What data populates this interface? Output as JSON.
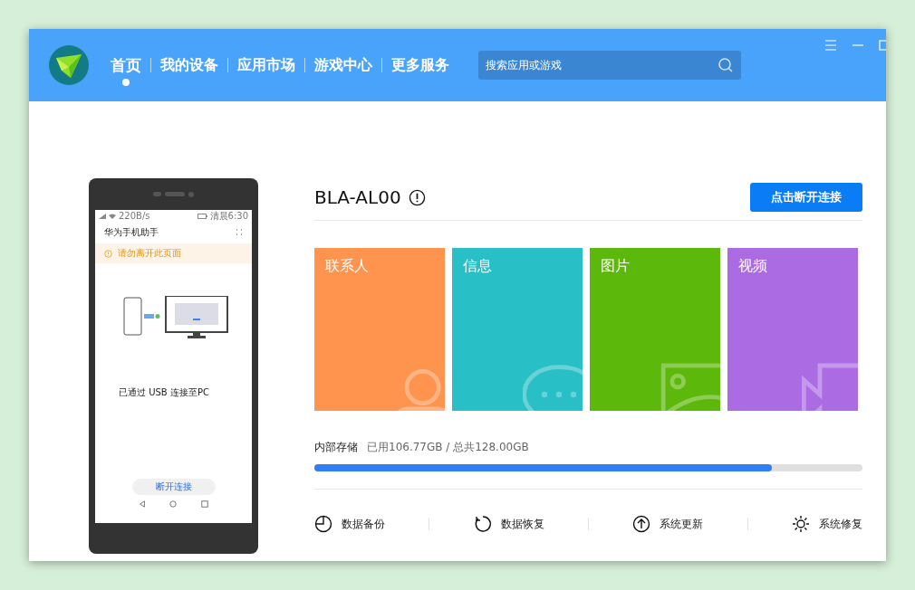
{
  "nav": {
    "items": [
      {
        "label": "首页",
        "selected": true
      },
      {
        "label": "我的设备",
        "selected": false
      },
      {
        "label": "应用市场",
        "selected": false
      },
      {
        "label": "游戏中心",
        "selected": false
      },
      {
        "label": "更多服务",
        "selected": false
      }
    ],
    "search": {
      "placeholder": "搜索应用或游戏"
    }
  },
  "phone": {
    "status_speed": "220B/s",
    "status_time": "清晨6:30",
    "app_title": "华为手机助手",
    "warning": "请勿离开此页面",
    "connection_text": "已通过 USB 连接至PC",
    "disconnect_button": "断开连接"
  },
  "device": {
    "name": "BLA-AL00",
    "disconnect_button": "点击断开连接"
  },
  "tiles": [
    {
      "label": "联系人",
      "kind": "contacts",
      "color": "#ff944f"
    },
    {
      "label": "信息",
      "kind": "messages",
      "color": "#28bfc6"
    },
    {
      "label": "图片",
      "kind": "photos",
      "color": "#5cb80a"
    },
    {
      "label": "视频",
      "kind": "videos",
      "color": "#ab6ce3"
    }
  ],
  "storage": {
    "label": "内部存储",
    "usage": "已用106.77GB / 总共128.00GB",
    "level": 0.834
  },
  "tools": [
    {
      "label": "数据备份",
      "kind": "backup"
    },
    {
      "label": "数据恢复",
      "kind": "restore"
    },
    {
      "label": "系统更新",
      "kind": "update"
    },
    {
      "label": "系统修复",
      "kind": "repair"
    }
  ]
}
